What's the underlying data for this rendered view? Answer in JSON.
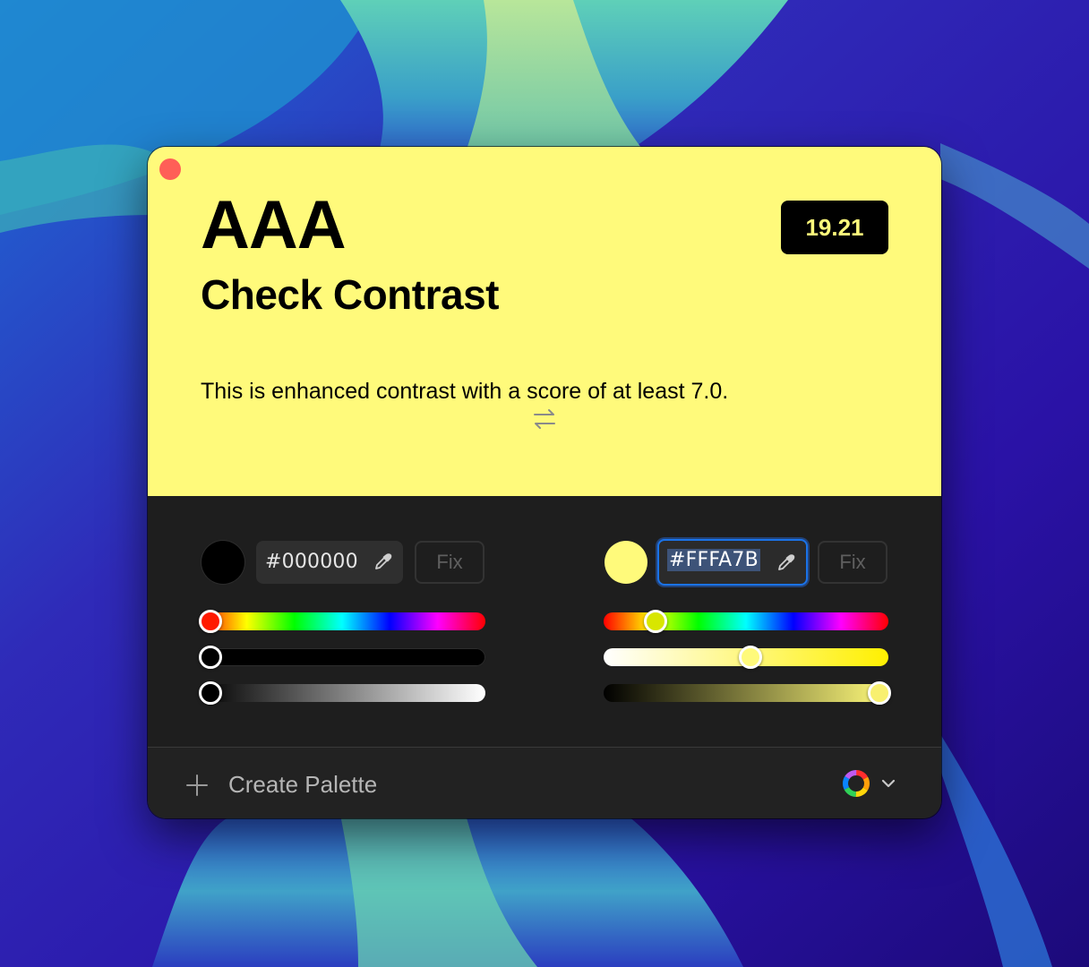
{
  "window": {
    "close_label": ""
  },
  "preview": {
    "grade": "AAA",
    "title": "Check Contrast",
    "description": "This is enhanced contrast with a score of at least 7.0.",
    "score": "19.21",
    "background_color": "#FFFA7B",
    "text_color": "#000000"
  },
  "foreground": {
    "hex": "#000000",
    "swatch_color": "#000000",
    "fix_label": "Fix",
    "sliders": {
      "hue": 0.0,
      "saturation": 0.0,
      "brightness": 0.0
    }
  },
  "background": {
    "hex": "#FFFA7B",
    "swatch_color": "#FFFA7B",
    "fix_label": "Fix",
    "sliders": {
      "hue": 0.17,
      "saturation": 0.52,
      "brightness": 0.97
    }
  },
  "footer": {
    "create_label": "Create Palette"
  },
  "icons": {
    "close": "close-icon",
    "eyedropper": "eyedropper-icon",
    "swap": "swap-arrows-icon",
    "plus": "plus-icon",
    "palette": "color-wheel-icon",
    "chevron": "chevron-down-icon"
  }
}
